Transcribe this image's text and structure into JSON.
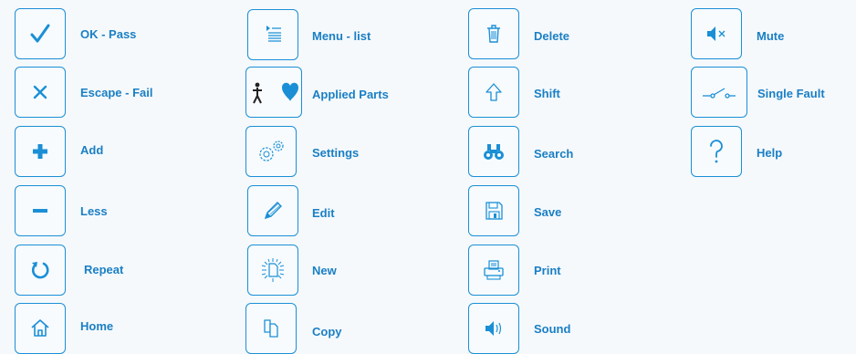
{
  "legend": {
    "accent_color": "#1b8fd6",
    "label_color": "#1a7fc4",
    "items": [
      {
        "icon": "check-icon",
        "label": "OK - Pass"
      },
      {
        "icon": "close-icon",
        "label": "Escape - Fail"
      },
      {
        "icon": "plus-icon",
        "label": "Add"
      },
      {
        "icon": "minus-icon",
        "label": "Less"
      },
      {
        "icon": "repeat-icon",
        "label": "Repeat"
      },
      {
        "icon": "home-icon",
        "label": "Home"
      },
      {
        "icon": "menu-list-icon",
        "label": "Menu - list"
      },
      {
        "icon": "applied-parts-icon",
        "label": "Applied Parts"
      },
      {
        "icon": "gear-icon",
        "label": "Settings"
      },
      {
        "icon": "pencil-icon",
        "label": "Edit"
      },
      {
        "icon": "new-document-icon",
        "label": "New"
      },
      {
        "icon": "copy-icon",
        "label": "Copy"
      },
      {
        "icon": "trash-icon",
        "label": "Delete"
      },
      {
        "icon": "shift-arrow-icon",
        "label": "Shift"
      },
      {
        "icon": "binoculars-icon",
        "label": "Search"
      },
      {
        "icon": "floppy-disk-icon",
        "label": "Save"
      },
      {
        "icon": "printer-icon",
        "label": "Print"
      },
      {
        "icon": "speaker-icon",
        "label": "Sound"
      },
      {
        "icon": "mute-icon",
        "label": "Mute"
      },
      {
        "icon": "switch-icon",
        "label": "Single Fault"
      },
      {
        "icon": "question-icon",
        "label": "Help"
      }
    ]
  }
}
